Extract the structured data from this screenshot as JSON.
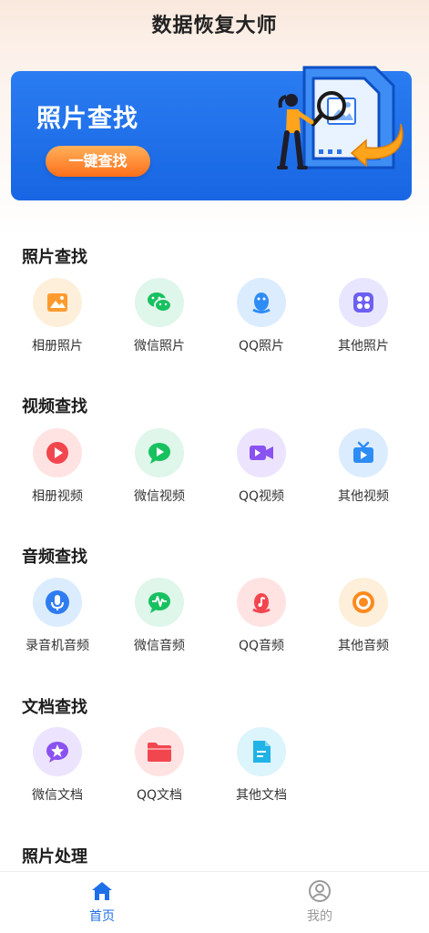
{
  "header": {
    "title": "数据恢复大师"
  },
  "banner": {
    "title": "照片查找",
    "button_label": "一键查找"
  },
  "sections": [
    {
      "title": "照片查找",
      "items": [
        {
          "label": "相册照片",
          "icon": "photo-album-icon",
          "bg": "#fdefd9",
          "color": "#ff9a2e"
        },
        {
          "label": "微信照片",
          "icon": "wechat-icon",
          "bg": "#dff6ea",
          "color": "#18c160"
        },
        {
          "label": "QQ照片",
          "icon": "qq-icon",
          "bg": "#dcecff",
          "color": "#2e8cf5"
        },
        {
          "label": "其他照片",
          "icon": "grid-dots-icon",
          "bg": "#e8e6ff",
          "color": "#6d5ff2"
        }
      ]
    },
    {
      "title": "视频查找",
      "items": [
        {
          "label": "相册视频",
          "icon": "play-circle-icon",
          "bg": "#ffe3e3",
          "color": "#f2464f"
        },
        {
          "label": "微信视频",
          "icon": "wechat-video-icon",
          "bg": "#dff6ea",
          "color": "#18c160"
        },
        {
          "label": "QQ视频",
          "icon": "video-camera-icon",
          "bg": "#ece4ff",
          "color": "#8a52f0"
        },
        {
          "label": "其他视频",
          "icon": "tv-icon",
          "bg": "#dcecff",
          "color": "#2e8cf5"
        }
      ]
    },
    {
      "title": "音频查找",
      "items": [
        {
          "label": "录音机音频",
          "icon": "microphone-icon",
          "bg": "#dcecff",
          "color": "#2e7cf0"
        },
        {
          "label": "微信音频",
          "icon": "wechat-audio-icon",
          "bg": "#dff6ea",
          "color": "#18c160"
        },
        {
          "label": "QQ音频",
          "icon": "qq-audio-icon",
          "bg": "#ffe3e3",
          "color": "#f2464f"
        },
        {
          "label": "其他音频",
          "icon": "record-icon",
          "bg": "#fdefd9",
          "color": "#ff8a1e"
        }
      ]
    },
    {
      "title": "文档查找",
      "items": [
        {
          "label": "微信文档",
          "icon": "star-chat-icon",
          "bg": "#ece4ff",
          "color": "#8a52f0"
        },
        {
          "label": "QQ文档",
          "icon": "folder-icon",
          "bg": "#ffe3e3",
          "color": "#f2464f"
        },
        {
          "label": "其他文档",
          "icon": "document-icon",
          "bg": "#dcf4fb",
          "color": "#21b3e6"
        }
      ]
    },
    {
      "title": "照片处理",
      "items": []
    }
  ],
  "tabbar": {
    "tabs": [
      {
        "label": "首页",
        "icon": "home-icon",
        "active": true
      },
      {
        "label": "我的",
        "icon": "profile-icon",
        "active": false
      }
    ],
    "active_color": "#1f6fe8",
    "inactive_color": "#999999"
  }
}
